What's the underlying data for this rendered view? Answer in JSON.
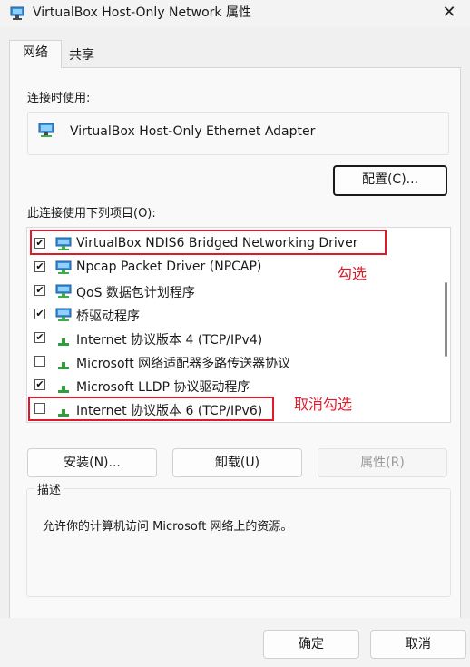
{
  "window": {
    "title": "VirtualBox Host-Only Network 属性",
    "close_label": "✕"
  },
  "tabs": [
    {
      "label": "网络",
      "active": true
    },
    {
      "label": "共享",
      "active": false
    }
  ],
  "connect_using_label": "连接时使用:",
  "adapter_name": "VirtualBox Host-Only Ethernet Adapter",
  "configure_button": "配置(C)...",
  "items_label": "此连接使用下列项目(O):",
  "items": [
    {
      "label": "VirtualBox NDIS6 Bridged Networking Driver",
      "checked": true,
      "icon": "network-client-icon"
    },
    {
      "label": "Npcap Packet Driver (NPCAP)",
      "checked": true,
      "icon": "network-client-icon"
    },
    {
      "label": "QoS 数据包计划程序",
      "checked": true,
      "icon": "network-client-icon"
    },
    {
      "label": "桥驱动程序",
      "checked": true,
      "icon": "network-client-icon"
    },
    {
      "label": "Internet 协议版本 4 (TCP/IPv4)",
      "checked": true,
      "icon": "protocol-icon"
    },
    {
      "label": "Microsoft 网络适配器多路传送器协议",
      "checked": false,
      "icon": "protocol-icon"
    },
    {
      "label": "Microsoft LLDP 协议驱动程序",
      "checked": true,
      "icon": "protocol-icon"
    },
    {
      "label": "Internet 协议版本 6 (TCP/IPv6)",
      "checked": false,
      "icon": "protocol-icon"
    }
  ],
  "annotations": {
    "check": "勾选",
    "uncheck": "取消勾选",
    "color": "#e0192a"
  },
  "buttons": {
    "install": "安装(N)...",
    "uninstall": "卸载(U)",
    "properties": "属性(R)"
  },
  "description": {
    "legend": "描述",
    "text": "允许你的计算机访问 Microsoft 网络上的资源。"
  },
  "footer": {
    "ok": "确定",
    "cancel": "取消"
  }
}
